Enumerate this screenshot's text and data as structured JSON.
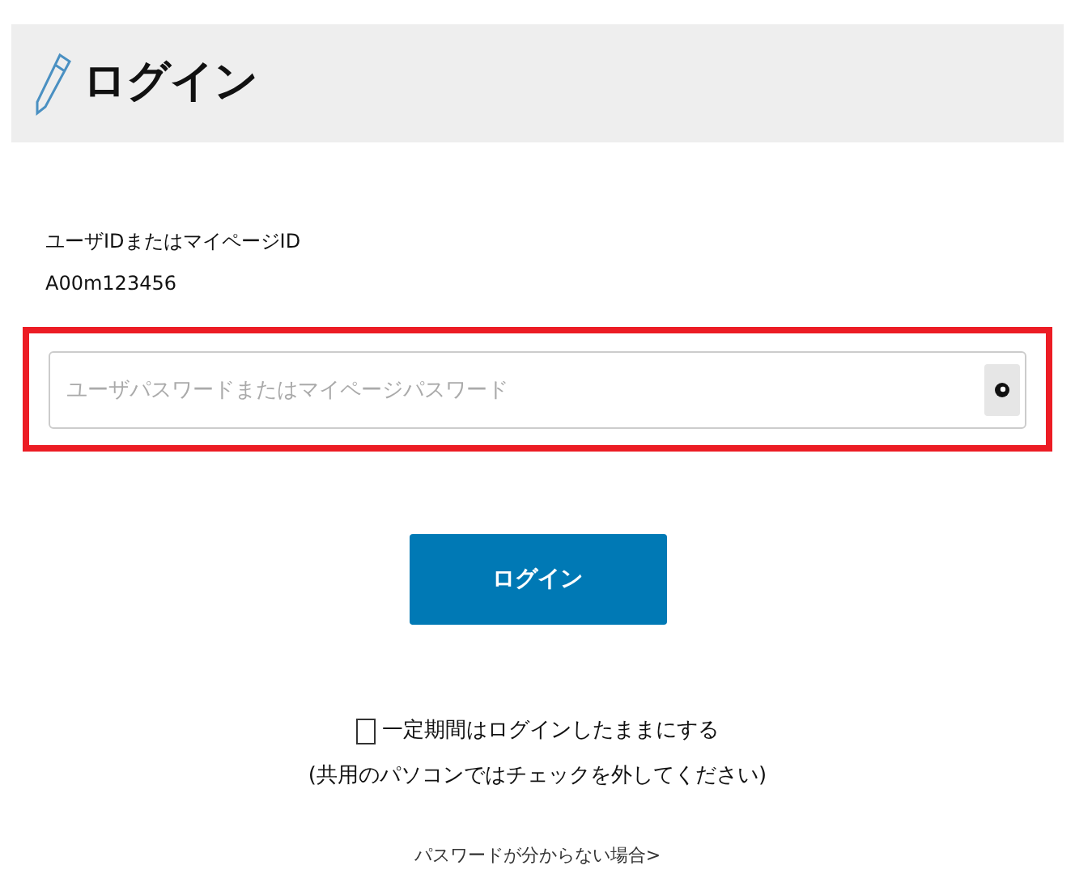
{
  "header": {
    "title": "ログイン"
  },
  "user_id": {
    "label": "ユーザIDまたはマイページID",
    "value": "A00m123456"
  },
  "password": {
    "placeholder": "ユーザパスワードまたはマイページパスワード",
    "highlighted": true
  },
  "login_button": {
    "label": "ログイン"
  },
  "remember": {
    "label": "一定期間はログインしたままにする",
    "checked": false,
    "note": "(共用のパソコンではチェックを外してください)"
  },
  "forgot_link": {
    "label": "パスワードが分からない場合>"
  }
}
